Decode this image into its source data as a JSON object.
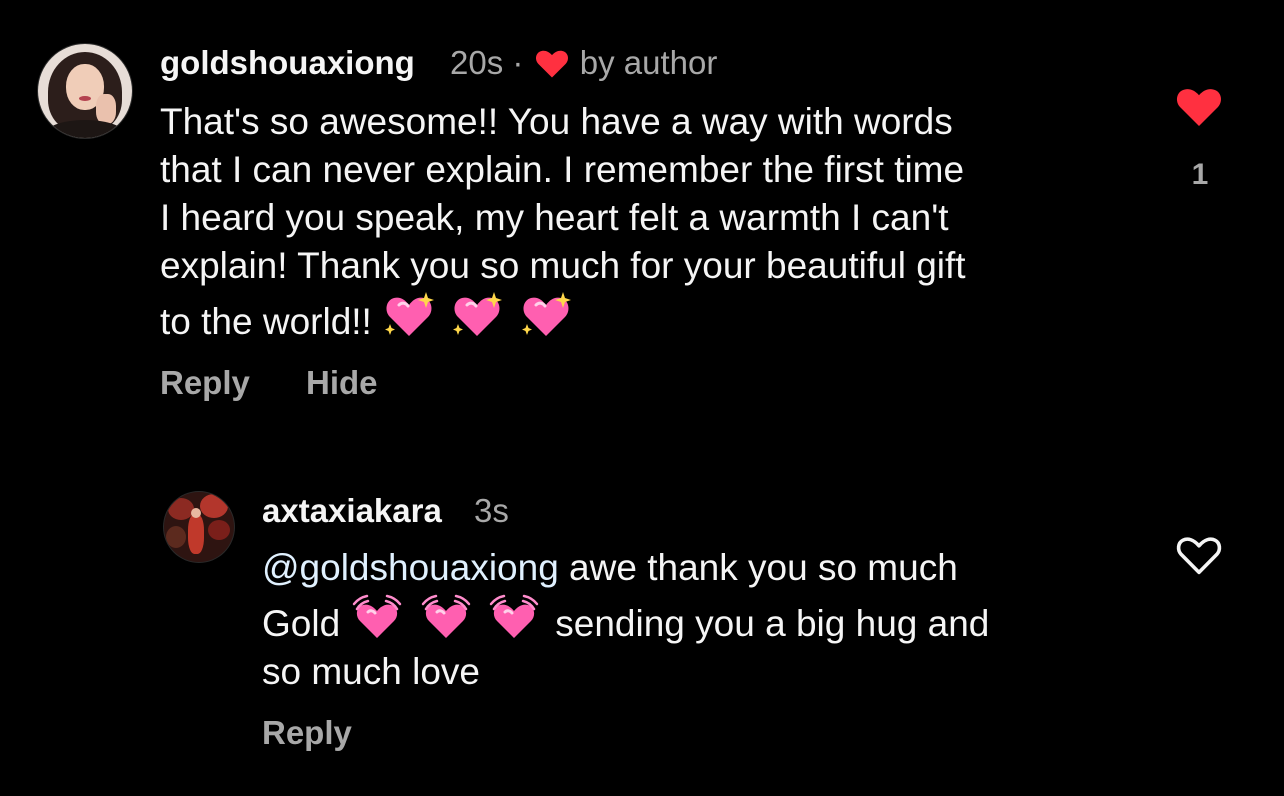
{
  "comments": [
    {
      "username": "goldshouaxiong",
      "time": "20s",
      "separator": "·",
      "liked_by": "by author",
      "lines": [
        "That's so awesome!! You have a way with words",
        "that I can never explain. I remember the first time",
        "I heard you speak, my heart felt a warmth I can't",
        "explain! Thank you so much for your beautiful gift",
        "to the world!!"
      ],
      "line5_emoji": [
        "sparkling-heart",
        "sparkling-heart",
        "sparkling-heart"
      ],
      "actions": {
        "reply": "Reply",
        "hide": "Hide"
      },
      "like": {
        "state": "liked",
        "count": "1",
        "color": "#ff3040"
      }
    },
    {
      "username": "axtaxiakara",
      "time": "3s",
      "mention": "@goldshouaxiong",
      "line1_rest": " awe thank you so much",
      "line2_start": "Gold",
      "line2_emoji": [
        "beating-heart",
        "beating-heart",
        "beating-heart"
      ],
      "line2_rest": "sending you a big hug and",
      "line3": "so much love",
      "actions": {
        "reply": "Reply"
      },
      "like": {
        "state": "not-liked"
      }
    }
  ],
  "colors": {
    "background": "#000000",
    "primary_text": "#f5f5f5",
    "secondary_text": "#a8a8a8",
    "like_red": "#ff3040",
    "emoji_pink": "#ff5fb0"
  }
}
